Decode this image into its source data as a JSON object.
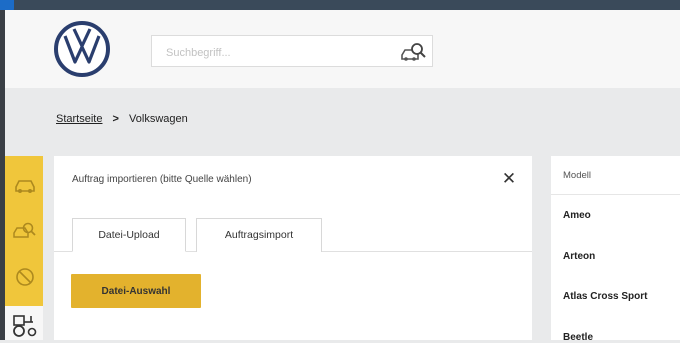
{
  "header": {
    "search_placeholder": "Suchbegriff..."
  },
  "breadcrumb": {
    "home": "Startseite",
    "separator": ">",
    "current": "Volkswagen"
  },
  "sidebar": {
    "items": [
      {
        "icon": "car-icon"
      },
      {
        "icon": "search-car-icon"
      },
      {
        "icon": "no-entry-icon"
      },
      {
        "icon": "tractor-icon"
      }
    ]
  },
  "import_panel": {
    "title": "Auftrag importieren (bitte Quelle wählen)",
    "close_label": "✕",
    "tabs": [
      "Datei-Upload",
      "Auftragsimport"
    ],
    "active_tab": "Datei-Upload",
    "file_button": "Datei-Auswahl"
  },
  "models": {
    "header": "Modell",
    "items": [
      "Ameo",
      "Arteon",
      "Atlas Cross Sport",
      "Beetle"
    ]
  },
  "colors": {
    "accent_yellow": "#f0c63b",
    "button_gold": "#e3b22d",
    "vw_blue": "#2a3e6e"
  }
}
